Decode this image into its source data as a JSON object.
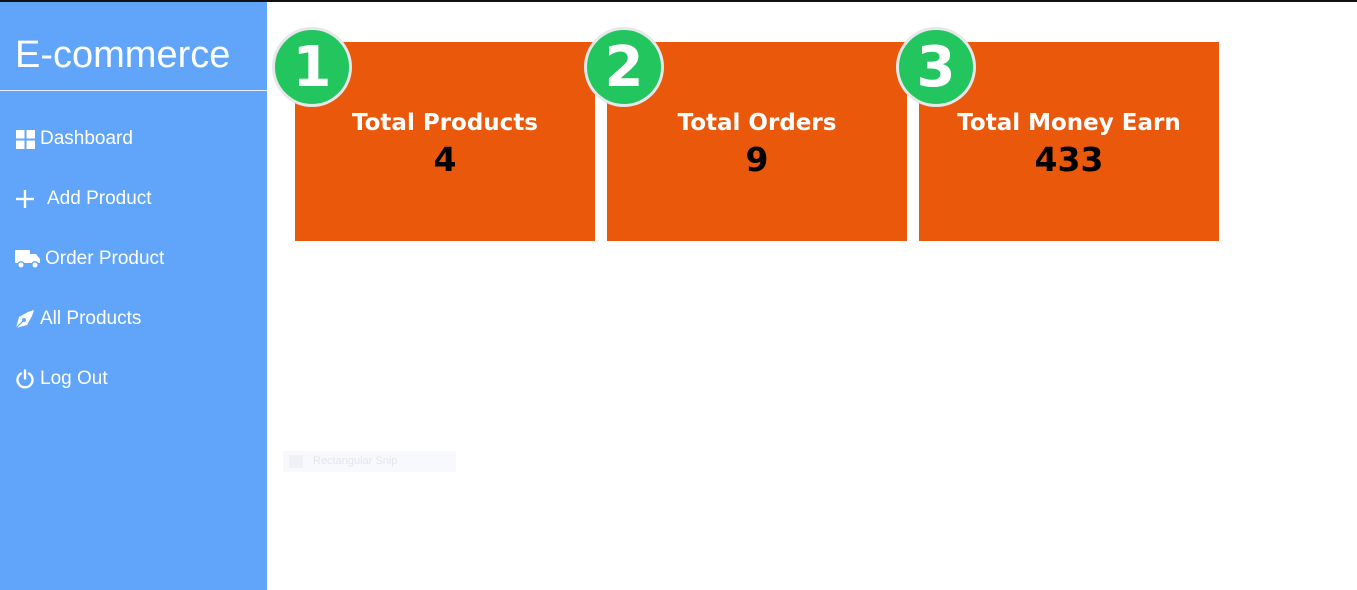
{
  "sidebar": {
    "brand": "E-commerce",
    "items": [
      {
        "label": "Dashboard",
        "icon": "windows-grid-icon"
      },
      {
        "label": "Add Product",
        "icon": "plus-icon"
      },
      {
        "label": "Order Product",
        "icon": "truck-icon"
      },
      {
        "label": "All Products",
        "icon": "pen-nib-icon"
      },
      {
        "label": "Log Out",
        "icon": "power-icon"
      }
    ]
  },
  "stats": [
    {
      "badge": "1",
      "label": "Total Products",
      "value": "4"
    },
    {
      "badge": "2",
      "label": "Total Orders",
      "value": "9"
    },
    {
      "badge": "3",
      "label": "Total Money Earn",
      "value": "433"
    }
  ],
  "overlay": {
    "label": "Rectangular Snip"
  },
  "colors": {
    "sidebar": "#60a5fa",
    "card": "#ea580c",
    "badge": "#22c55e"
  }
}
